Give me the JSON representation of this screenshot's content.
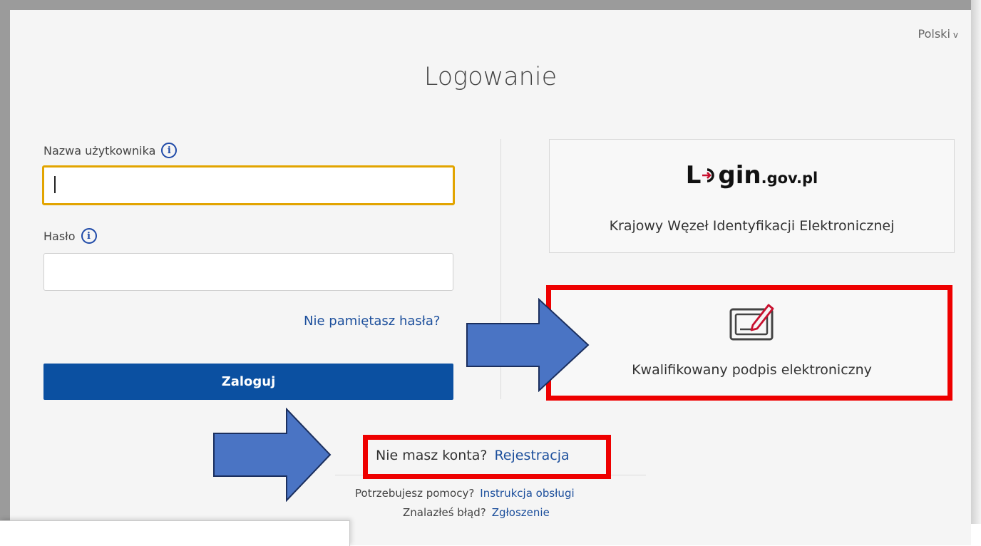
{
  "header": {
    "language": "Polski",
    "language_chevron": "v",
    "title": "Logowanie"
  },
  "form": {
    "username_label": "Nazwa użytkownika",
    "username_value": "",
    "password_label": "Hasło",
    "password_value": "",
    "forgot_link": "Nie pamiętasz hasła?",
    "login_button": "Zaloguj"
  },
  "options": {
    "login_gov": {
      "logo_main_start": "L",
      "logo_main_end": "gin",
      "logo_suffix": ".gov.pl",
      "description": "Krajowy Węzeł Identyfikacji Elektronicznej"
    },
    "qualified_signature": {
      "icon": "signature-pen-icon",
      "label": "Kwalifikowany podpis elektroniczny"
    }
  },
  "footer": {
    "no_account": "Nie masz konta?",
    "register_link": "Rejestracja",
    "help_text": "Potrzebujesz pomocy?",
    "help_link": "Instrukcja obsługi",
    "bug_text": "Znalazłeś błąd?",
    "bug_link": "Zgłoszenie"
  },
  "annotations": {
    "highlight_color": "#ee0000",
    "arrow_color": "#4a74c4"
  }
}
